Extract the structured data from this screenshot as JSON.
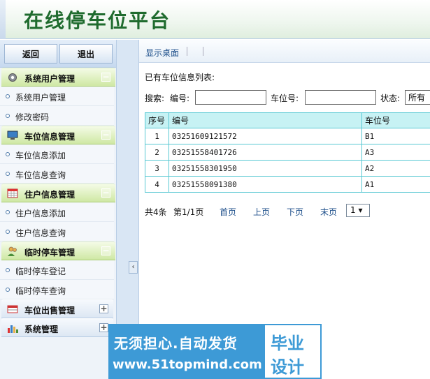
{
  "app": {
    "title": "在线停车位平台"
  },
  "sidebar": {
    "back_label": "返回",
    "exit_label": "退出",
    "groups": [
      {
        "label": "系统用户管理",
        "icon": "gear-icon",
        "expanded": true,
        "toggle": "−",
        "items": [
          {
            "label": "系统用户管理"
          },
          {
            "label": "修改密码"
          }
        ]
      },
      {
        "label": "车位信息管理",
        "icon": "monitor-icon",
        "expanded": true,
        "toggle": "−",
        "items": [
          {
            "label": "车位信息添加"
          },
          {
            "label": "车位信息查询"
          }
        ]
      },
      {
        "label": "住户信息管理",
        "icon": "calendar-icon",
        "expanded": true,
        "toggle": "−",
        "items": [
          {
            "label": "住户信息添加"
          },
          {
            "label": "住户信息查询"
          }
        ]
      },
      {
        "label": "临时停车管理",
        "icon": "users-icon",
        "expanded": true,
        "toggle": "−",
        "items": [
          {
            "label": "临时停车登记"
          },
          {
            "label": "临时停车查询"
          }
        ]
      },
      {
        "label": "车位出售管理",
        "icon": "table-icon",
        "expanded": false,
        "toggle": "+"
      },
      {
        "label": "系统管理",
        "icon": "bar-chart-icon",
        "expanded": false,
        "toggle": "+"
      }
    ],
    "collapse_glyph": "‹"
  },
  "main": {
    "tab_label": "显示桌面",
    "list_title": "已有车位信息列表:",
    "search": {
      "prefix": "搜索:",
      "number_label": "编号:",
      "number_value": "",
      "slot_label": "车位号:",
      "slot_value": "",
      "status_label": "状态:",
      "status_value": "所有"
    },
    "table": {
      "headers": [
        "序号",
        "编号",
        "车位号"
      ],
      "rows": [
        {
          "index": "1",
          "number": "03251609121572",
          "slot": "B1"
        },
        {
          "index": "2",
          "number": "03251558401726",
          "slot": "A3"
        },
        {
          "index": "3",
          "number": "03251558301950",
          "slot": "A2"
        },
        {
          "index": "4",
          "number": "03251558091380",
          "slot": "A1"
        }
      ]
    },
    "pager": {
      "total": "共4条",
      "page_info": "第1/1页",
      "first": "首页",
      "prev": "上页",
      "next": "下页",
      "last": "末页",
      "page_select": "1 ▾"
    }
  },
  "watermark": {
    "line1": "无须担心.自动发货",
    "line2": "www.51topmind.com",
    "box_top": "毕业",
    "box_bottom": "设计"
  },
  "colors": {
    "title_green": "#1f6b2e",
    "group_green": "#cfe8a4",
    "table_header": "#c7f2f4",
    "table_border": "#58c8d3",
    "watermark_blue": "#3d9ad6"
  }
}
